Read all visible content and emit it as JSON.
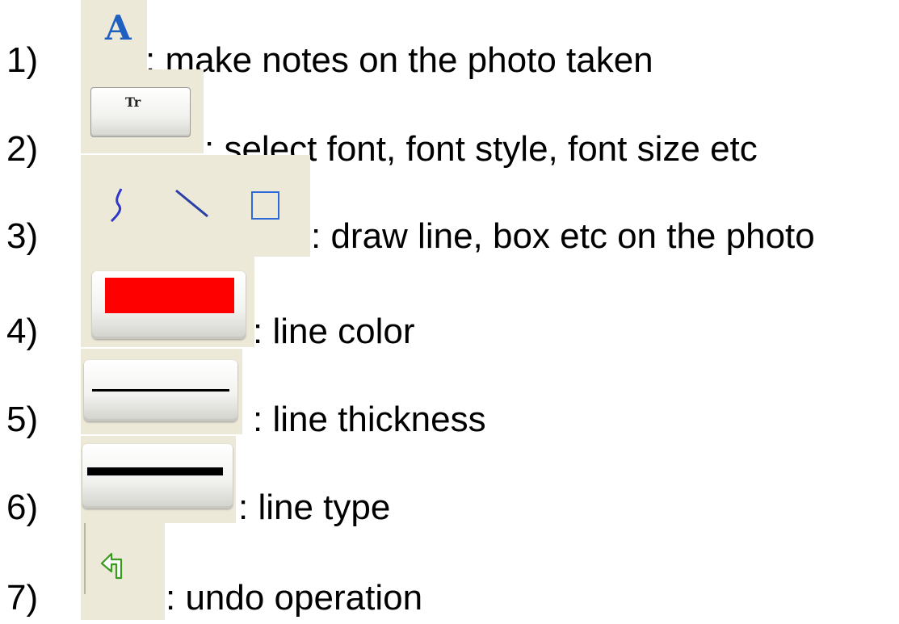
{
  "items": [
    {
      "number": "1)",
      "description": ": make notes on the photo taken",
      "icon": "text-annotation-a-icon"
    },
    {
      "number": "2)",
      "description": ": select font, font style, font size etc",
      "icon": "font-tr-icon",
      "icon_text": "Tr"
    },
    {
      "number": "3)",
      "description": ": draw line, box etc on the photo",
      "icon": "draw-tools-icons"
    },
    {
      "number": "4)",
      "description": ": line color",
      "icon": "line-color-icon",
      "swatch_color": "#ff0000"
    },
    {
      "number": "5)",
      "description": ": line thickness",
      "icon": "line-thickness-icon"
    },
    {
      "number": "6)",
      "description": ": line type",
      "icon": "line-type-icon"
    },
    {
      "number": "7)",
      "description": ": undo operation",
      "icon": "undo-arrow-icon"
    }
  ],
  "icon_a_glyph": "A"
}
